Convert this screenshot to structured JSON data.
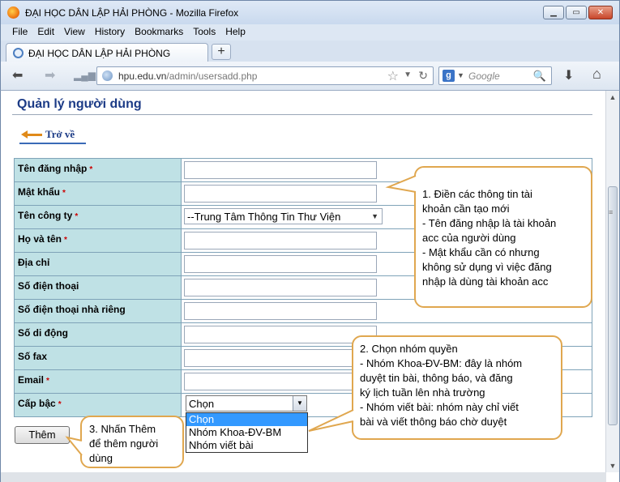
{
  "window": {
    "title": "ĐẠI HỌC DÂN LẬP HẢI PHÒNG - Mozilla Firefox",
    "controls": [
      "minimize",
      "maximize",
      "close"
    ]
  },
  "menu": {
    "items": [
      {
        "label": "File"
      },
      {
        "label": "Edit"
      },
      {
        "label": "View"
      },
      {
        "label": "History"
      },
      {
        "label": "Bookmarks"
      },
      {
        "label": "Tools"
      },
      {
        "label": "Help"
      }
    ]
  },
  "tabs": {
    "active_label": "ĐẠI HỌC DÂN LẬP HẢI PHÒNG",
    "new_tab_symbol": "+"
  },
  "navigation": {
    "url_host": "hpu.edu.vn",
    "url_path": "/admin/usersadd.php",
    "search_placeholder": "Google",
    "search_engine_letter": "g"
  },
  "page": {
    "title": "Quản lý người dùng",
    "back_label": "Trở về",
    "fields": [
      {
        "label": "Tên đăng nhập",
        "required": true,
        "type": "text",
        "value": ""
      },
      {
        "label": "Mật khẩu",
        "required": true,
        "type": "password",
        "value": ""
      },
      {
        "label": "Tên công ty",
        "required": true,
        "type": "select",
        "value": "--Trung Tâm Thông Tin Thư Viện"
      },
      {
        "label": "Họ và tên",
        "required": true,
        "type": "text",
        "value": ""
      },
      {
        "label": "Địa chỉ",
        "required": false,
        "type": "text",
        "value": ""
      },
      {
        "label": "Số điện thoại",
        "required": false,
        "type": "text",
        "value": ""
      },
      {
        "label": "Số điện thoại nhà riêng",
        "required": false,
        "type": "text",
        "value": ""
      },
      {
        "label": "Số di động",
        "required": false,
        "type": "text",
        "value": ""
      },
      {
        "label": "Số fax",
        "required": false,
        "type": "text",
        "value": ""
      },
      {
        "label": "Email",
        "required": true,
        "type": "text",
        "value": ""
      },
      {
        "label": "Cấp bậc",
        "required": true,
        "type": "select",
        "value": "Chọn"
      }
    ],
    "required_marker": "*",
    "rank_options": [
      "Chọn",
      "Nhóm Khoa-ĐV-BM",
      "Nhóm viết bài"
    ],
    "rank_selected": "Chọn",
    "submit_label": "Thêm"
  },
  "callouts": {
    "c1": [
      "1. Điền các thông tin tài",
      "khoản cần tạo mới",
      "- Tên đăng nhập là tài khoản",
      "acc của người dùng",
      "- Mật khẩu cần có nhưng",
      "không sử dụng vì việc đăng",
      "nhập là dùng tài khoản acc"
    ],
    "c2": [
      "2. Chọn nhóm quyền",
      "- Nhóm Khoa-ĐV-BM: đây là nhóm",
      "duyệt tin bài, thông báo, và đăng",
      "ký lịch tuần lên nhà trường",
      "- Nhóm viết bài: nhóm này chỉ viết",
      "bài và viết thông báo chờ duyệt"
    ],
    "c3": [
      "3. Nhấn Thêm",
      "để thêm người",
      "dùng"
    ]
  },
  "colors": {
    "label_bg": "#bfe1e5",
    "title_blue": "#1c3b86",
    "required_red": "#cc0000",
    "callout_border": "#e0a74f",
    "dropdown_highlight": "#3399ff"
  }
}
